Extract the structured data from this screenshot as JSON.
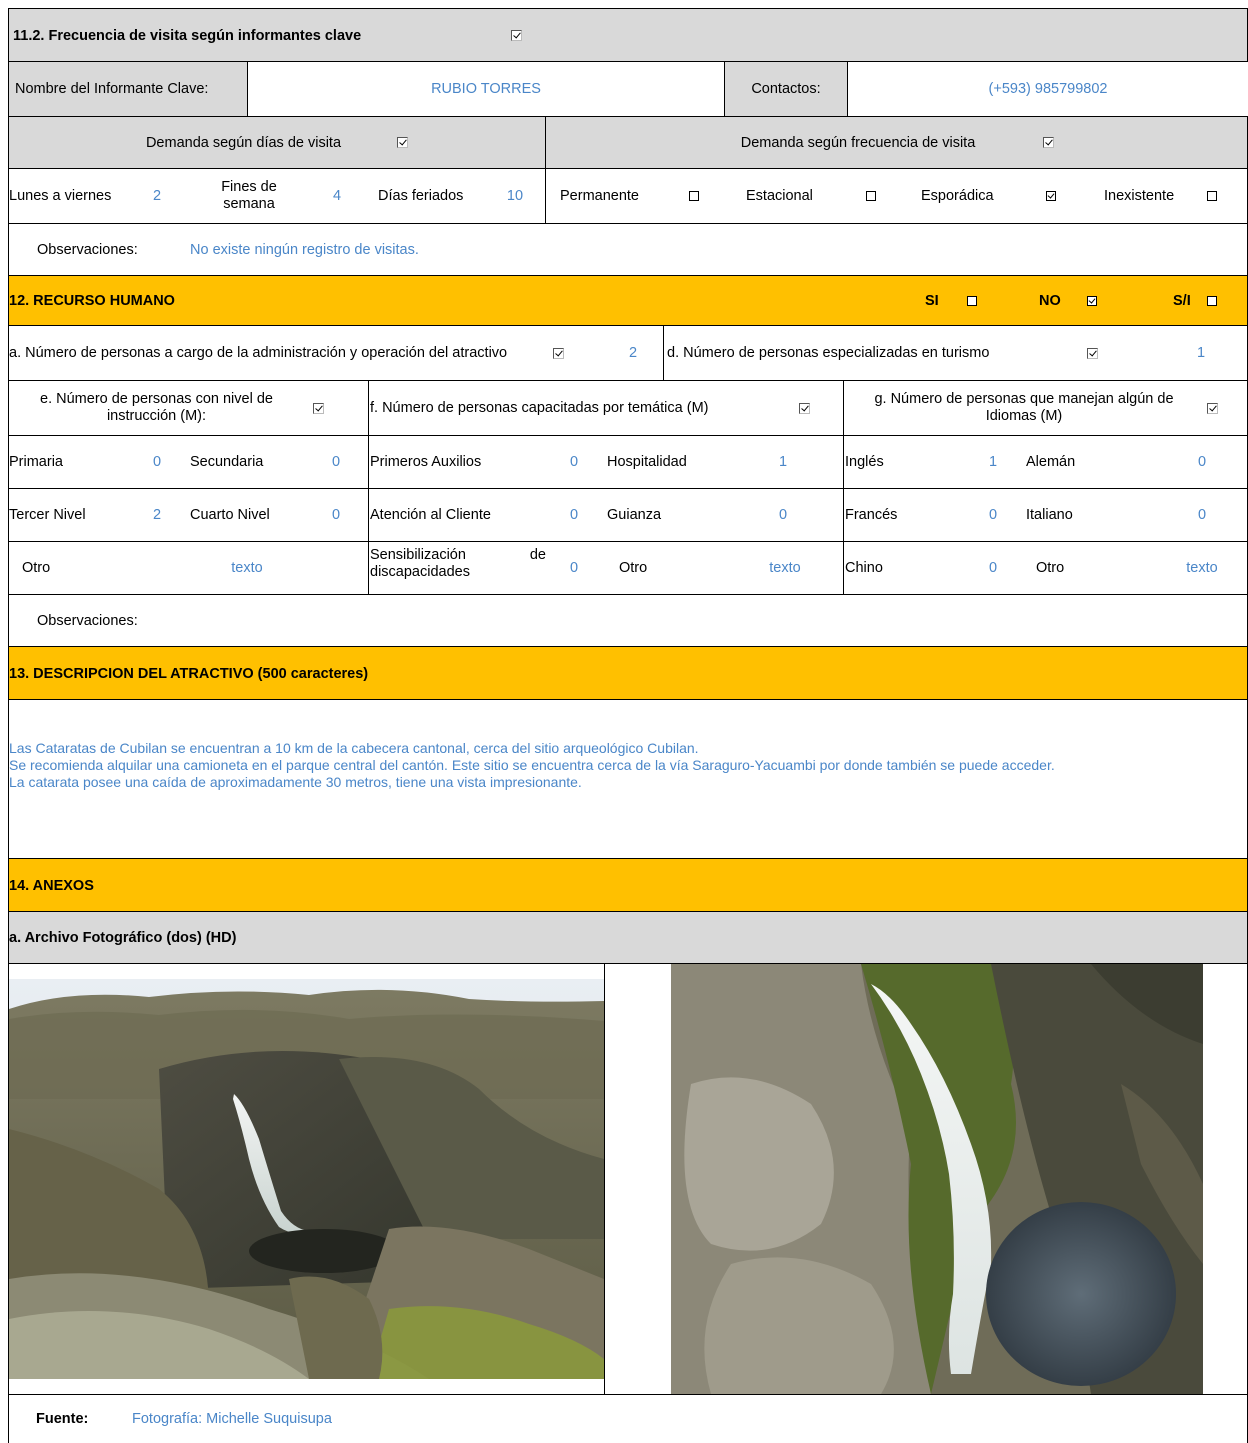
{
  "s11": {
    "title": "11.2. Frecuencia de visita según informantes clave",
    "informant_label": "Nombre del Informante Clave:",
    "informant_value": "RUBIO TORRES",
    "contacts_label": "Contactos:",
    "contacts_value": "(+593) 985799802",
    "demand_days_label": "Demanda según  días de visita",
    "demand_freq_label": "Demanda según frecuencia de visita",
    "weekdays_label": "Lunes a viernes",
    "weekdays_value": "2",
    "weekend_label": "Fines de semana",
    "weekend_value": "4",
    "holidays_label": "Días feriados",
    "holidays_value": "10",
    "freq_options": [
      {
        "label": "Permanente",
        "checked": false
      },
      {
        "label": "Estacional",
        "checked": false
      },
      {
        "label": "Esporádica",
        "checked": true
      },
      {
        "label": "Inexistente",
        "checked": false
      }
    ],
    "obs_label": "Observaciones:",
    "obs_value": "No existe ningún registro de visitas."
  },
  "s12": {
    "title": "12. RECURSO HUMANO",
    "si_label": "SI",
    "no_label": "NO",
    "sn_label": "S/I",
    "a_label": "a. Número de personas a cargo de la administración y operación del atractivo",
    "a_value": "2",
    "d_label": "d. Número de personas especializadas en turismo",
    "d_value": "1",
    "e_label": "e. Número de personas con nivel de instrucción (M):",
    "f_label": "f. Número de personas capacitadas por temática (M)",
    "g_label": "g. Número de personas que manejan algún de Idiomas (M)",
    "primaria_label": "Primaria",
    "primaria_value": "0",
    "secundaria_label": "Secundaria",
    "secundaria_value": "0",
    "tercer_label": "Tercer Nivel",
    "tercer_value": "2",
    "cuarto_label": "Cuarto Nivel",
    "cuarto_value": "0",
    "otro_e_label": "Otro",
    "otro_e_value": "texto",
    "aux_label": "Primeros Auxilios",
    "aux_value": "0",
    "hosp_label": "Hospitalidad",
    "hosp_value": "1",
    "aten_label": "Atención al Cliente",
    "aten_value": "0",
    "guia_label": "Guianza",
    "guia_value": "0",
    "sens_label_1": "Sensibilización",
    "sens_label_2": "de",
    "sens_label_3": "discapacidades",
    "sens_value": "0",
    "otro_f_label": "Otro",
    "otro_f_value": "texto",
    "ingles_label": "Inglés",
    "ingles_value": "1",
    "aleman_label": "Alemán",
    "aleman_value": "0",
    "frances_label": "Francés",
    "frances_value": "0",
    "italiano_label": "Italiano",
    "italiano_value": "0",
    "chino_label": "Chino",
    "chino_value": "0",
    "otro_g_label": "Otro",
    "otro_g_value": "texto",
    "obs_label": "Observaciones:"
  },
  "s13": {
    "title": "13. DESCRIPCION DEL ATRACTIVO (500 caracteres)",
    "lines": [
      "Las Cataratas de Cubilan se encuentran a 10 km de la cabecera cantonal, cerca del sitio arqueológico Cubilan.",
      "Se recomienda alquilar una camioneta en el parque central del cantón. Este sitio se encuentra cerca de la vía Saraguro-Yacuambi por donde también se puede acceder.",
      "La catarata posee una caída de aproximadamente 30 metros, tiene una vista impresionante."
    ]
  },
  "s14": {
    "title": "14. ANEXOS",
    "photo_title": "a. Archivo Fotográfico (dos) (HD)",
    "source_label": "Fuente:",
    "source_value": "Fotografía: Michelle Suquisupa"
  },
  "colors": {
    "header_gold": "#ffc000",
    "header_grey": "#d9d9d9",
    "value_blue": "#4a86c8"
  }
}
